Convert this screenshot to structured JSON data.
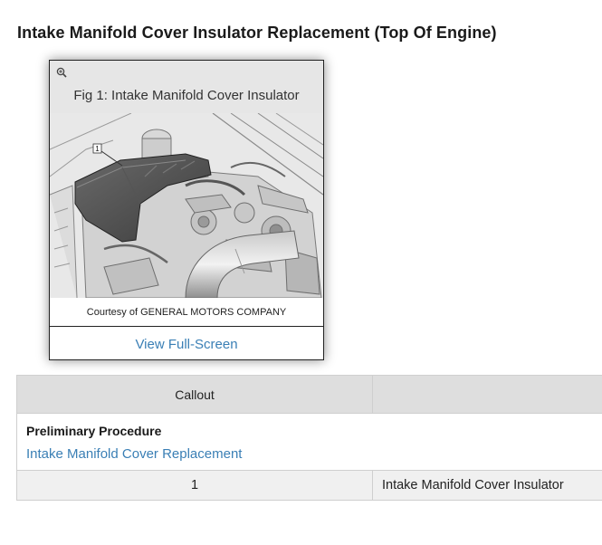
{
  "page": {
    "title": "Intake Manifold Cover Insulator Replacement (Top Of Engine)"
  },
  "figure": {
    "zoom_icon": "zoom-in-icon",
    "caption": "Fig 1: Intake Manifold Cover Insulator",
    "courtesy": "Courtesy of GENERAL MOTORS COMPANY",
    "view_fullscreen": "View Full-Screen",
    "callout_marker": "1"
  },
  "table": {
    "headers": [
      "Callout",
      ""
    ],
    "preliminary": {
      "title": "Preliminary Procedure",
      "link": "Intake Manifold Cover Replacement"
    },
    "rows": [
      {
        "callout": "1",
        "description": "Intake Manifold Cover Insulator"
      }
    ]
  },
  "colors": {
    "link": "#3a7fb5",
    "header_bg": "#dedede",
    "row_bg": "#f0f0f0"
  }
}
